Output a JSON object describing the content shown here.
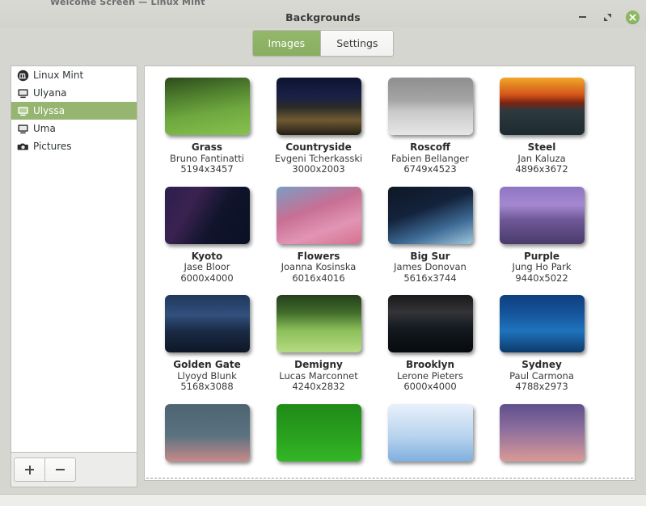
{
  "desktop": {
    "background_window_title": "Welcome Screen — Linux Mint"
  },
  "window": {
    "title": "Backgrounds",
    "controls": {
      "minimize": "minimize-button",
      "maximize": "maximize-button",
      "close": "close-button"
    }
  },
  "tabs": [
    {
      "label": "Images",
      "active": true
    },
    {
      "label": "Settings",
      "active": false
    }
  ],
  "sidebar": {
    "items": [
      {
        "label": "Linux Mint",
        "icon": "linux-mint-logo-icon",
        "selected": false
      },
      {
        "label": "Ulyana",
        "icon": "monitor-icon",
        "selected": false
      },
      {
        "label": "Ulyssa",
        "icon": "monitor-icon",
        "selected": true
      },
      {
        "label": "Uma",
        "icon": "monitor-icon",
        "selected": false
      },
      {
        "label": "Pictures",
        "icon": "camera-icon",
        "selected": false
      }
    ],
    "toolbar": {
      "add_label": "+",
      "remove_label": "−"
    }
  },
  "colors": {
    "accent_green": "#8cb863",
    "selection_green": "#95b571",
    "window_chrome": "#d6d6d1",
    "panel_white": "#ffffff"
  },
  "wallpapers": [
    {
      "title": "Grass",
      "author": "Bruno Fantinatti",
      "size": "5194x3457",
      "thumb": "grass-thumbnail",
      "css": "linear-gradient(170deg,#2d4a1c 0%,#4b7a2c 28%,#6fa83f 60%,#86c24f 100%)"
    },
    {
      "title": "Countryside",
      "author": "Evgeni Tcherkasski",
      "size": "3000x2003",
      "thumb": "countryside-thumbnail",
      "css": "linear-gradient(180deg,#0d1430 0%,#1a2046 32%,#2a2b27 52%,#6f5a33 74%,#241f16 100%)"
    },
    {
      "title": "Roscoff",
      "author": "Fabien Bellanger",
      "size": "6749x4523",
      "thumb": "roscoff-thumbnail",
      "css": "linear-gradient(180deg,#8f8f8f 0%,#a5a5a5 40%,#c9c9c9 58%,#e6e6e6 100%)"
    },
    {
      "title": "Steel",
      "author": "Jan Kaluza",
      "size": "4896x3672",
      "thumb": "steel-thumbnail",
      "css": "linear-gradient(180deg,#f0a82a 0%,#d4541a 30%,#7a2410 44%,#2c3a40 58%,#1d2a30 100%)"
    },
    {
      "title": "Kyoto",
      "author": "Jase Bloor",
      "size": "6000x4000",
      "thumb": "kyoto-thumbnail",
      "css": "linear-gradient(120deg,#2b1f4e 0%,#3a2250 30%,#10142c 60%,#0b1024 100%)"
    },
    {
      "title": "Flowers",
      "author": "Joanna Kosinska",
      "size": "6016x4016",
      "thumb": "flowers-thumbnail",
      "css": "linear-gradient(160deg,#7c9dc4 0%,#c76f94 40%,#e294b4 70%,#d4738f 100%)"
    },
    {
      "title": "Big Sur",
      "author": "James Donovan",
      "size": "5616x3744",
      "thumb": "big-sur-thumbnail",
      "css": "linear-gradient(160deg,#0e1724 0%,#13233c 40%,#3e6b96 70%,#9ec6dd 100%)"
    },
    {
      "title": "Purple",
      "author": "Jung Ho Park",
      "size": "9440x5022",
      "thumb": "purple-thumbnail",
      "css": "linear-gradient(180deg,#8f76c4 0%,#a487cf 32%,#6e5796 58%,#4a3b6b 100%)"
    },
    {
      "title": "Golden Gate",
      "author": "Llyoyd Blunk",
      "size": "5168x3088",
      "thumb": "golden-gate-thumbnail",
      "css": "linear-gradient(180deg,#20375c 0%,#31507c 35%,#1b2b46 62%,#0e1726 100%)"
    },
    {
      "title": "Demigny",
      "author": "Lucas Marconnet",
      "size": "4240x2832",
      "thumb": "demigny-thumbnail",
      "css": "linear-gradient(180deg,#24401c 0%,#416b2a 30%,#8cc05a 62%,#b7da84 100%)"
    },
    {
      "title": "Brooklyn",
      "author": "Lerone Pieters",
      "size": "6000x4000",
      "thumb": "brooklyn-thumbnail",
      "css": "linear-gradient(180deg,#1a1a1c 0%,#343438 30%,#141a20 58%,#070a0d 100%)"
    },
    {
      "title": "Sydney",
      "author": "Paul Carmona",
      "size": "4788x2973",
      "thumb": "sydney-thumbnail",
      "css": "linear-gradient(180deg,#0f3f7e 0%,#16579e 35%,#1f74bd 62%,#0c3a6b 100%)"
    }
  ],
  "partial_row": [
    {
      "thumb": "cut-off-thumbnail-1",
      "css": "linear-gradient(180deg,#4d6471 0%,#5b7280 55%,#c88a8a 100%)"
    },
    {
      "thumb": "cut-off-thumbnail-2",
      "css": "linear-gradient(180deg,#1f8a17 0%,#2aa31f 60%,#33b726 100%)"
    },
    {
      "thumb": "cut-off-thumbnail-3",
      "css": "linear-gradient(180deg,#e8f1fb 0%,#b9d4ee 55%,#7fb0df 100%)"
    },
    {
      "thumb": "cut-off-thumbnail-4",
      "css": "linear-gradient(180deg,#5e4f8c 0%,#8f6f9e 45%,#d99a95 100%)"
    }
  ]
}
